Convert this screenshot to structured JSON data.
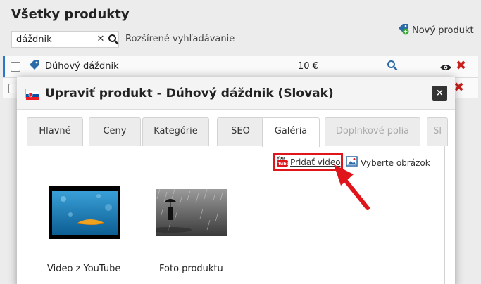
{
  "page": {
    "title": "Všetky produkty",
    "search": {
      "value": "dáždnik",
      "placeholder": ""
    },
    "advanced_search_label": "Rozšírené vyhľadávanie",
    "new_product_label": "Nový produkt",
    "rows": [
      {
        "name": "Dúhový dáždnik",
        "price": "10 €"
      }
    ]
  },
  "modal": {
    "title": "Upraviť produkt - Dúhový dáždnik (Slovak)",
    "close_label": "×",
    "tabs": [
      {
        "label": "Hlavné",
        "active": false,
        "disabled": false
      },
      {
        "label": "Ceny",
        "active": false,
        "disabled": false
      },
      {
        "label": "Kategórie",
        "active": false,
        "disabled": false
      },
      {
        "label": "SEO",
        "active": false,
        "disabled": false
      },
      {
        "label": "Galéria",
        "active": true,
        "disabled": false
      },
      {
        "label": "Doplnkové polia",
        "active": false,
        "disabled": true
      },
      {
        "label": "Sl",
        "active": false,
        "disabled": true
      }
    ],
    "gallery": {
      "add_video_label": "Pridať video",
      "choose_image_label": "Vyberte obrázok",
      "items": [
        {
          "caption": "Video z YouTube"
        },
        {
          "caption": "Foto produktu"
        }
      ]
    }
  },
  "colors": {
    "highlight": "#e0151b",
    "delete": "#c9211e",
    "accent": "#2a78c9"
  },
  "icons": [
    "search-icon",
    "clear-icon",
    "add-tag-icon",
    "tag-icon",
    "magnifier-icon",
    "eye-icon",
    "delete-icon",
    "slovak-flag-icon",
    "close-icon",
    "youtube-icon",
    "image-icon",
    "arrow-annotation"
  ]
}
